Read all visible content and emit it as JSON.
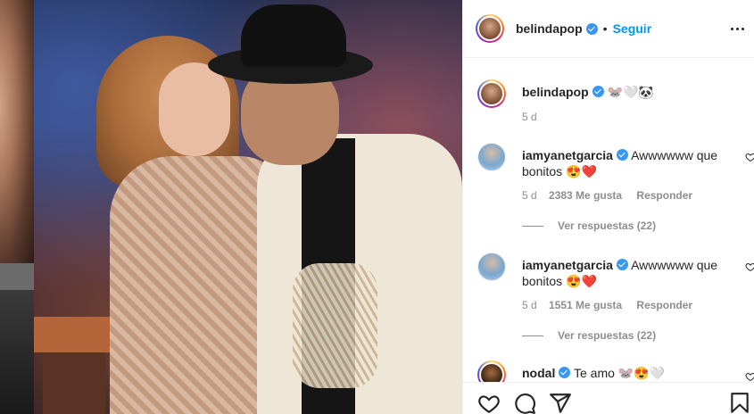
{
  "post": {
    "author": "belindapop",
    "dot": "•",
    "follow_label": "Seguir",
    "more_icon": "more-options-icon"
  },
  "caption": {
    "username": "belindapop",
    "text": "🐭🤍🐼",
    "time": "5 d"
  },
  "comments": [
    {
      "username": "iamyanetgarcia",
      "text": "Awwwwww que bonitos 😍❤️",
      "time": "5 d",
      "likes": "2383 Me gusta",
      "reply_label": "Responder",
      "view_replies": "Ver respuestas (22)"
    },
    {
      "username": "iamyanetgarcia",
      "text": "Awwwwww que bonitos 😍❤️",
      "time": "5 d",
      "likes": "1551 Me gusta",
      "reply_label": "Responder",
      "view_replies": "Ver respuestas (22)"
    },
    {
      "username": "nodal",
      "text": "Te amo 🐭😍🤍"
    }
  ],
  "actions": {
    "icons": [
      "heart-icon",
      "comment-icon",
      "share-icon",
      "bookmark-icon"
    ]
  },
  "colors": {
    "link_blue": "#0095f6",
    "verified_blue": "#3897f0",
    "text": "#262626",
    "muted": "#8e8e8e"
  }
}
